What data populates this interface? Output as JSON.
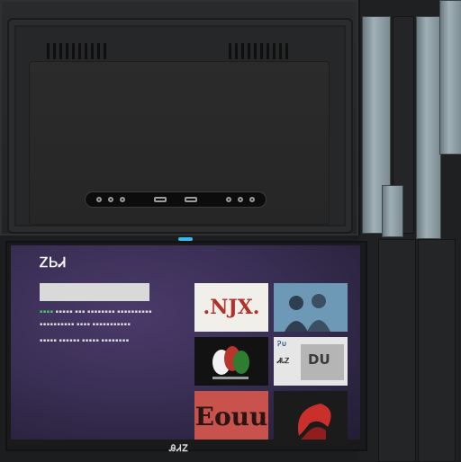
{
  "tv": {
    "app_logo": "ᏃᏏᏗ",
    "search_placeholder": "",
    "meta_line_1": "▪▪▪▪▪ ▪▪▪ ▪▪▪▪▪▪▪▪ ▪▪▪▪▪▪▪▪▪▪",
    "meta_line_2": "▪▪▪▪▪▪▪▪▪▪ ▪▪▪▪ ▪▪▪▪▪▪▪▪▪▪▪",
    "meta_line_3": "▪▪▪▪▪ ▪▪▪▪▪▪ ▪▪▪▪▪ ▪▪▪▪▪▪▪▪",
    "tiles": [
      {
        "label": ".NJX.",
        "bg": "#f1efe9",
        "fg": "#b3312c"
      },
      {
        "label": "",
        "bg": "#5f8aa8",
        "fg": "#ffffff"
      },
      {
        "label": "",
        "bg": "#121212",
        "fg": "#ffffff"
      },
      {
        "label": "DU",
        "bg": "#e6e6e6",
        "fg": "#2a2a2a",
        "top_text": "Ꭾ∪",
        "left_text": "ᏗᏓᏃ"
      },
      {
        "label": "Eouu",
        "bg": "#c8534d",
        "fg": "#2a1414"
      },
      {
        "label": "",
        "bg": "#1b1b1b",
        "fg": "#ffffff"
      }
    ],
    "brand": "ᎯᏗᏃ"
  },
  "colors": {
    "led": "#3fb6e8",
    "screen": "#3a2f55",
    "accent_green": "#55c26b"
  }
}
